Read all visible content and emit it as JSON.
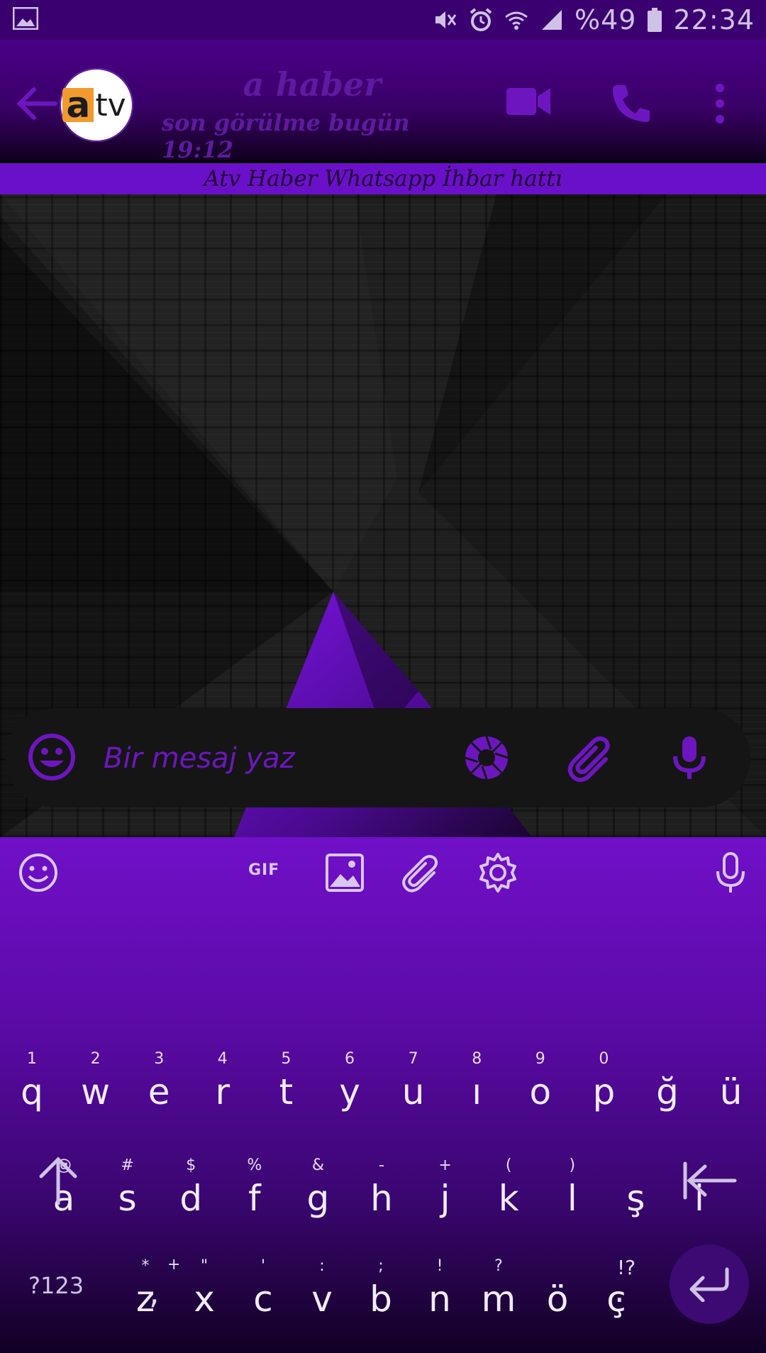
{
  "status_bar": {
    "battery": "%49",
    "time": "22:34"
  },
  "header": {
    "avatar_letter": "a",
    "avatar_suffix": "tv",
    "contact_name": "a haber",
    "last_seen": "son görülme bugün 19:12"
  },
  "banner": {
    "text": "Atv Haber Whatsapp İhbar hattı"
  },
  "input_bar": {
    "placeholder": "Bir mesaj yaz"
  },
  "keyboard": {
    "gif_label": "GIF",
    "row1": [
      {
        "hint": "1",
        "key": "q"
      },
      {
        "hint": "2",
        "key": "w"
      },
      {
        "hint": "3",
        "key": "e"
      },
      {
        "hint": "4",
        "key": "r"
      },
      {
        "hint": "5",
        "key": "t"
      },
      {
        "hint": "6",
        "key": "y"
      },
      {
        "hint": "7",
        "key": "u"
      },
      {
        "hint": "8",
        "key": "ı"
      },
      {
        "hint": "9",
        "key": "o"
      },
      {
        "hint": "0",
        "key": "p"
      },
      {
        "hint": "",
        "key": "ğ"
      },
      {
        "hint": "",
        "key": "ü"
      }
    ],
    "row2": [
      {
        "hint": "@",
        "key": "a"
      },
      {
        "hint": "#",
        "key": "s"
      },
      {
        "hint": "$",
        "key": "d"
      },
      {
        "hint": "%",
        "key": "f"
      },
      {
        "hint": "&",
        "key": "g"
      },
      {
        "hint": "-",
        "key": "h"
      },
      {
        "hint": "+",
        "key": "j"
      },
      {
        "hint": "(",
        "key": "k"
      },
      {
        "hint": ")",
        "key": "l"
      },
      {
        "hint": "",
        "key": "ş"
      },
      {
        "hint": "",
        "key": "i"
      }
    ],
    "row3": [
      {
        "hint": "*",
        "key": "z"
      },
      {
        "hint": "\"",
        "key": "x"
      },
      {
        "hint": "'",
        "key": "c"
      },
      {
        "hint": ":",
        "key": "v"
      },
      {
        "hint": ";",
        "key": "b"
      },
      {
        "hint": "!",
        "key": "n"
      },
      {
        "hint": "?",
        "key": "m"
      },
      {
        "hint": "",
        "key": "ö"
      },
      {
        "hint": "",
        "key": "ç"
      }
    ],
    "symbols_label": "?123",
    "comma_key": ",",
    "comma_hint": "+",
    "period_key": ".",
    "period_hint": "!?"
  },
  "colors": {
    "accent": "#6d16c0",
    "header_bg": "#3a0068",
    "banner_bg": "#6a10c8",
    "keyboard_top": "#7010c8",
    "keyboard_bottom": "#120024"
  }
}
